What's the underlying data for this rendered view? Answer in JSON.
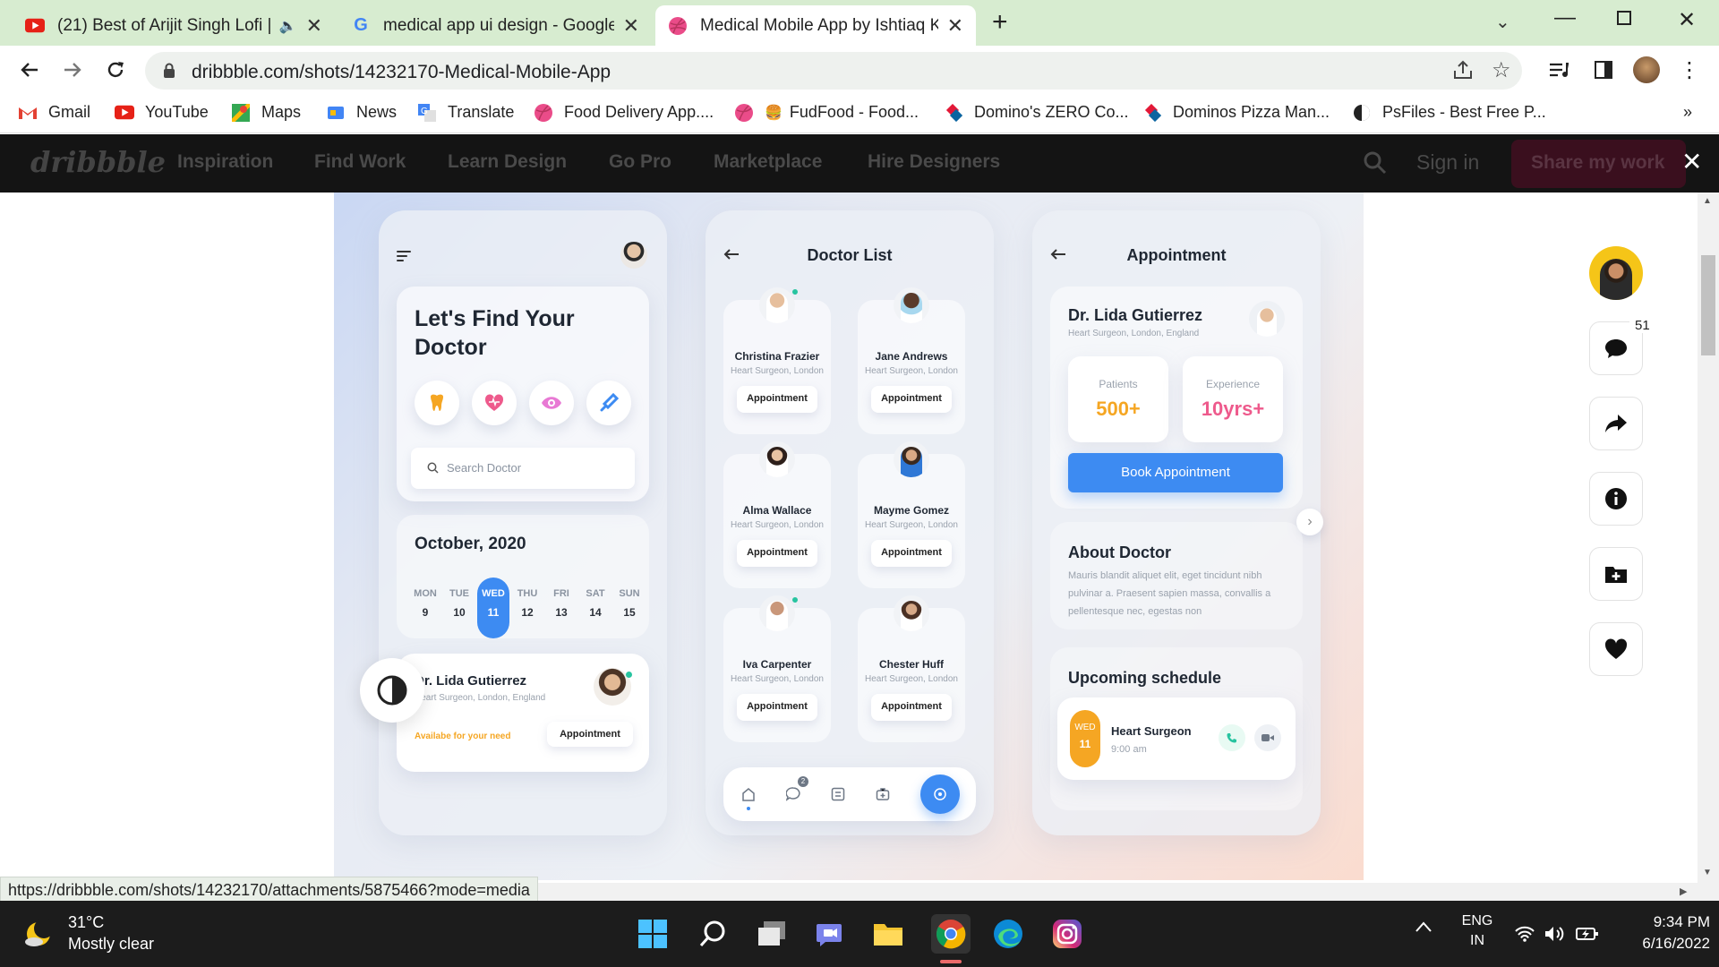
{
  "browser": {
    "tabs": [
      {
        "title": "(21) Best of Arijit Singh Lofi |",
        "icon": "youtube-icon"
      },
      {
        "title": "medical app ui design - Google S",
        "icon": "google-icon"
      },
      {
        "title": "Medical Mobile App by Ishtiaq Kh",
        "icon": "dribbble-icon"
      }
    ],
    "url": "dribbble.com/shots/14232170-Medical-Mobile-App",
    "bookmarks": [
      "Gmail",
      "YouTube",
      "Maps",
      "News",
      "Translate",
      "Food Delivery App....",
      "FudFood - Food...",
      "Domino's ZERO Co...",
      "Dominos Pizza Man...",
      "PsFiles - Best Free P..."
    ],
    "overflow": "»"
  },
  "dribbble": {
    "logo": "dribbble",
    "nav": [
      "Inspiration",
      "Find Work",
      "Learn Design",
      "Go Pro",
      "Marketplace",
      "Hire Designers"
    ],
    "sign_in": "Sign in",
    "share": "Share my work",
    "comments_count": "51"
  },
  "screen1": {
    "heading_line1": "Let's Find Your",
    "heading_line2": "Doctor",
    "search_placeholder": "Search Doctor",
    "month": "October, 2020",
    "days": [
      {
        "d": "MON",
        "n": "9"
      },
      {
        "d": "TUE",
        "n": "10"
      },
      {
        "d": "WED",
        "n": "11"
      },
      {
        "d": "THU",
        "n": "12"
      },
      {
        "d": "FRI",
        "n": "13"
      },
      {
        "d": "SAT",
        "n": "14"
      },
      {
        "d": "SUN",
        "n": "15"
      }
    ],
    "doctor_name": "Dr. Lida Gutierrez",
    "doctor_sub": "Heart Surgeon, London, England",
    "available": "Availabe for your need",
    "appointment": "Appointment"
  },
  "screen2": {
    "title": "Doctor List",
    "doctors": [
      {
        "name": "Christina Frazier",
        "sub": "Heart Surgeon, London",
        "btn": "Appointment"
      },
      {
        "name": "Jane Andrews",
        "sub": "Heart Surgeon, London",
        "btn": "Appointment"
      },
      {
        "name": "Alma Wallace",
        "sub": "Heart Surgeon, London",
        "btn": "Appointment"
      },
      {
        "name": "Mayme Gomez",
        "sub": "Heart Surgeon, London",
        "btn": "Appointment"
      },
      {
        "name": "Iva Carpenter",
        "sub": "Heart Surgeon, London",
        "btn": "Appointment"
      },
      {
        "name": "Chester Huff",
        "sub": "Heart Surgeon, London",
        "btn": "Appointment"
      }
    ],
    "chat_badge": "2"
  },
  "screen3": {
    "title": "Appointment",
    "doctor_name": "Dr. Lida Gutierrez",
    "doctor_sub": "Heart Surgeon, London, England",
    "patients_label": "Patients",
    "patients_value": "500+",
    "experience_label": "Experience",
    "experience_value": "10yrs+",
    "book": "Book Appointment",
    "about_title": "About Doctor",
    "about_text": "Mauris blandit aliquet elit, eget tincidunt nibh pulvinar a. Praesent sapien massa, convallis a pellentesque nec, egestas non",
    "upcoming": "Upcoming schedule",
    "sched_day": "WED",
    "sched_date": "11",
    "sched_title": "Heart Surgeon",
    "sched_time": "9:00 am"
  },
  "status_url": "https://dribbble.com/shots/14232170/attachments/5875466?mode=media",
  "taskbar": {
    "temp": "31°C",
    "weather": "Mostly clear",
    "lang1": "ENG",
    "lang2": "IN",
    "time": "9:34 PM",
    "date": "6/16/2022"
  },
  "colors": {
    "accent_blue": "#3d8bf2",
    "orange": "#f5a623",
    "pink": "#ee5a8c",
    "dribbble_pink": "#ea4c89"
  }
}
